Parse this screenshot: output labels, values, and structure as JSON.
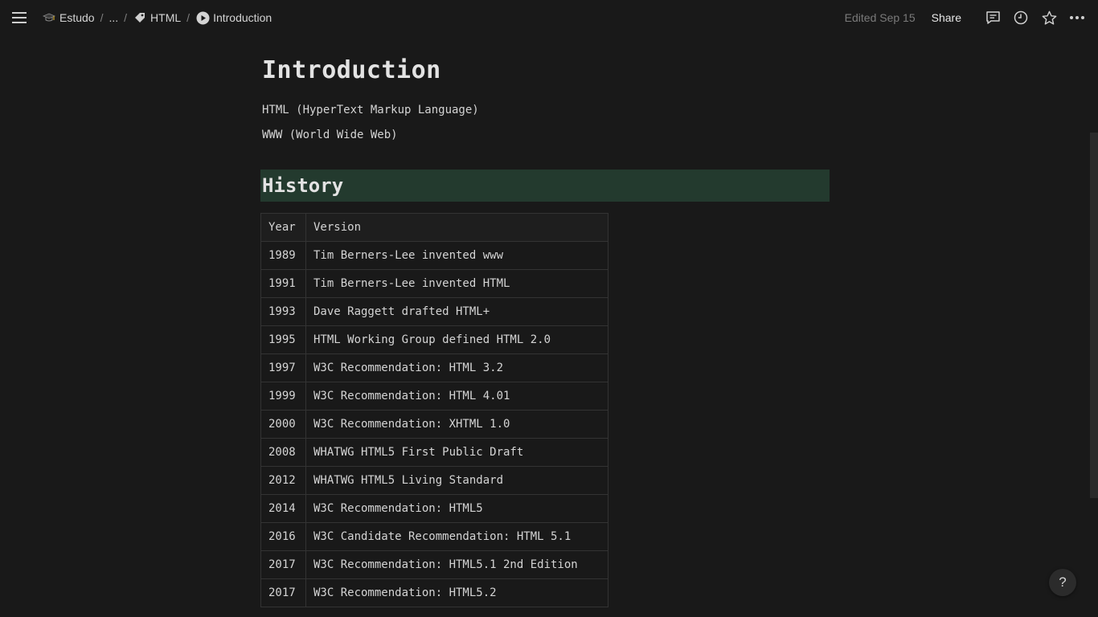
{
  "topbar": {
    "breadcrumb": [
      {
        "label": "Estudo",
        "icon": "graduation-cap-icon"
      },
      {
        "label": "...",
        "icon": ""
      },
      {
        "label": "HTML",
        "icon": "tag-icon"
      },
      {
        "label": "Introduction",
        "icon": "play-circle-icon"
      }
    ],
    "separator": "/",
    "edited": "Edited Sep 15",
    "share": "Share"
  },
  "page": {
    "title": "Introduction",
    "paragraphs": [
      "HTML (HyperText Markup Language)",
      "WWW (World Wide Web)"
    ],
    "heading": "History",
    "heading_bg": "#233a2e",
    "table": {
      "columns": [
        "Year",
        "Version"
      ],
      "rows": [
        [
          "1989",
          "Tim Berners-Lee invented www"
        ],
        [
          "1991",
          "Tim Berners-Lee invented HTML"
        ],
        [
          "1993",
          "Dave Raggett drafted HTML+"
        ],
        [
          "1995",
          "HTML Working Group defined HTML 2.0"
        ],
        [
          "1997",
          "W3C Recommendation: HTML 3.2"
        ],
        [
          "1999",
          "W3C Recommendation: HTML 4.01"
        ],
        [
          "2000",
          "W3C Recommendation: XHTML 1.0"
        ],
        [
          "2008",
          "WHATWG HTML5 First Public Draft"
        ],
        [
          "2012",
          "WHATWG HTML5 Living Standard"
        ],
        [
          "2014",
          "W3C Recommendation: HTML5"
        ],
        [
          "2016",
          "W3C Candidate Recommendation: HTML 5.1"
        ],
        [
          "2017",
          "W3C Recommendation: HTML5.1 2nd Edition"
        ],
        [
          "2017",
          "W3C Recommendation: HTML5.2"
        ]
      ]
    }
  },
  "help_label": "?"
}
